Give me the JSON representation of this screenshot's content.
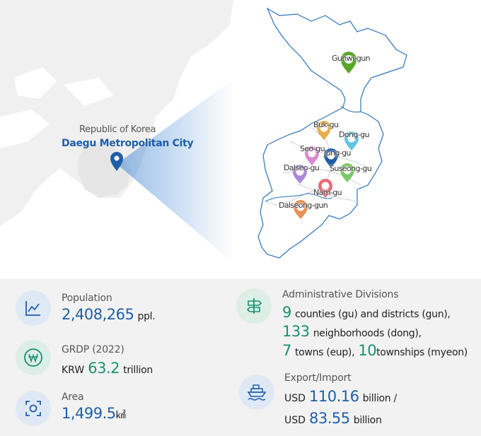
{
  "map": {
    "country": "Republic of Korea",
    "city": "Daegu Metropolitan City",
    "districts": [
      {
        "name": "Gunwi-gun",
        "color": "#5aa62a"
      },
      {
        "name": "Buk-gu",
        "color": "#e7b04a"
      },
      {
        "name": "Dong-gu",
        "color": "#5fc6e3"
      },
      {
        "name": "Seo-gu",
        "color": "#d98ad0"
      },
      {
        "name": "Jung-gu",
        "color": "#1f5fa8"
      },
      {
        "name": "Dalseo-gu",
        "color": "#a98ad8"
      },
      {
        "name": "Suseong-gu",
        "color": "#7cc86a"
      },
      {
        "name": "Nam-gu",
        "color": "#e86a7a"
      },
      {
        "name": "Dalseong-gun",
        "color": "#e8915a"
      }
    ]
  },
  "stats": {
    "population": {
      "label": "Population",
      "value": "2,408,265",
      "unit": "ppl.",
      "icon": "line-chart-icon"
    },
    "grdp": {
      "label": "GRDP (2022)",
      "prefix": "KRW",
      "value": "63.2",
      "unit": "trillion",
      "icon": "won-icon"
    },
    "area": {
      "label": "Area",
      "value": "1,499.5",
      "unit": "㎢",
      "icon": "focus-icon"
    },
    "admin": {
      "label": "Administrative Divisions",
      "icon": "signpost-icon",
      "line1_num": "9",
      "line1_text": "counties (gu) and districts (gun),",
      "line2_num": "133",
      "line2_text": "neighborhoods (dong),",
      "line3_num_a": "7",
      "line3_text_a": "towns (eup),",
      "line3_num_b": "10",
      "line3_text_b": "townships (myeon)"
    },
    "trade": {
      "label": "Export/Import",
      "icon": "ship-icon",
      "prefix1": "USD",
      "value1": "110.16",
      "unit1": "billion /",
      "prefix2": "USD",
      "value2": "83.55",
      "unit2": "billion"
    }
  },
  "colors": {
    "blue": "#1f5fa8",
    "green": "#1a9070",
    "panel": "#f2f2f2",
    "land": "#f0f0f0",
    "outline": "#2c73b9"
  }
}
